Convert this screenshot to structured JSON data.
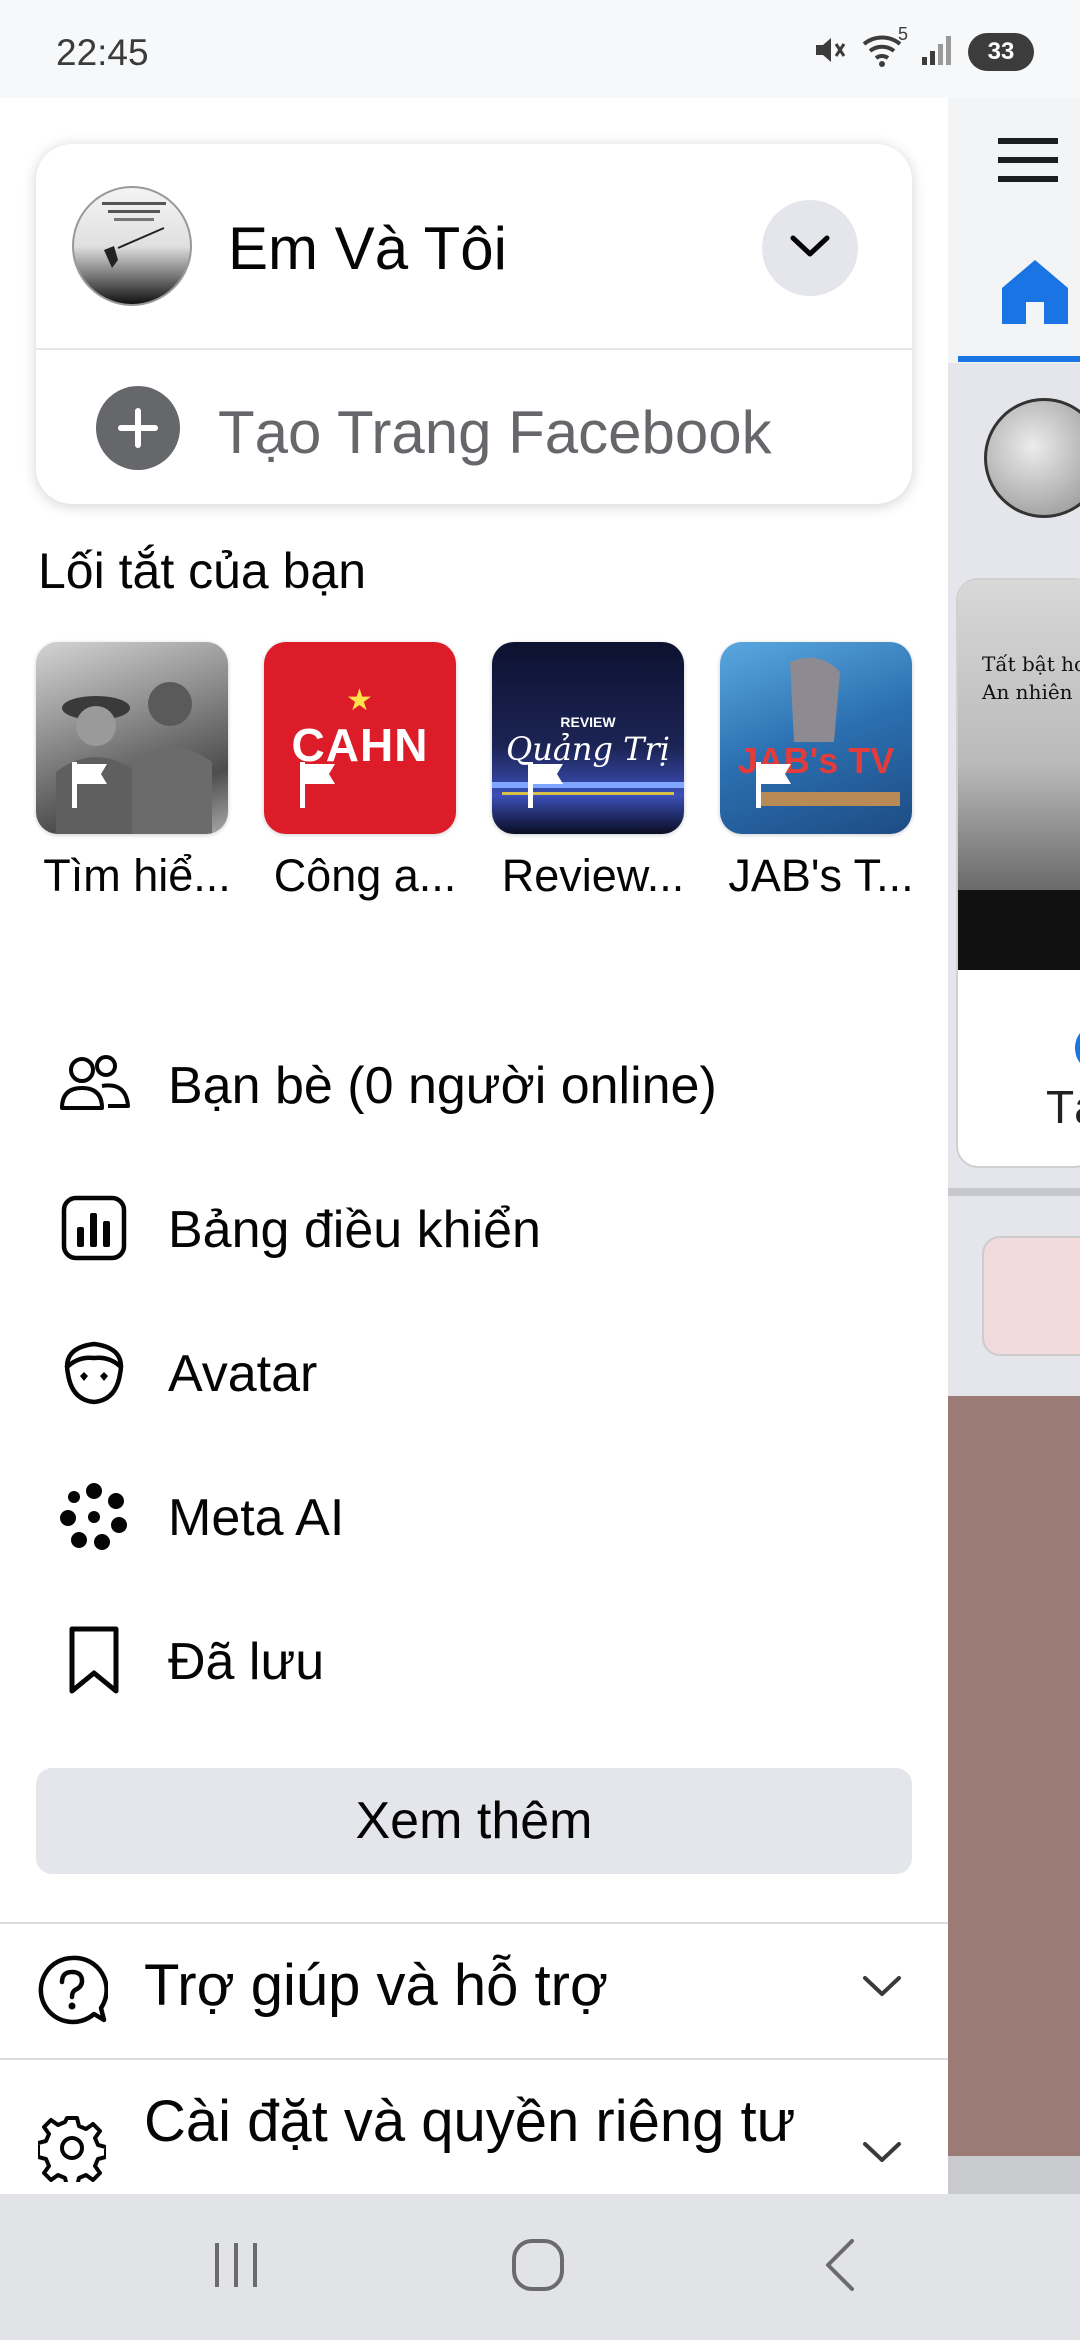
{
  "status_bar": {
    "time": "22:45",
    "wifi_badge": "5",
    "battery": "33",
    "icons": [
      "mute-icon",
      "wifi-icon",
      "signal-icon",
      "battery-icon"
    ]
  },
  "profile": {
    "name": "Em Và Tôi",
    "avatar_icon": "profile-avatar"
  },
  "create_page": {
    "label": "Tạo Trang Facebook"
  },
  "shortcuts": {
    "title": "Lối tắt của bạn",
    "items": [
      {
        "label": "Tìm hiể...",
        "thumb_text": ""
      },
      {
        "label": "Công a...",
        "thumb_text": "CAHN"
      },
      {
        "label": "Review...",
        "thumb_text": "REVIEW"
      },
      {
        "label": "JAB's T...",
        "thumb_text": "JAB's TV"
      }
    ]
  },
  "menu": {
    "items": [
      {
        "label": "Bạn bè (0 người online)",
        "icon": "friends-icon"
      },
      {
        "label": "Bảng điều khiển",
        "icon": "dashboard-icon"
      },
      {
        "label": "Avatar",
        "icon": "avatar-icon"
      },
      {
        "label": "Meta AI",
        "icon": "meta-ai-icon"
      },
      {
        "label": "Đã lưu",
        "icon": "bookmark-icon"
      }
    ],
    "see_more": "Xem thêm"
  },
  "sections": {
    "help": "Trợ giúp và hỗ trợ",
    "settings": "Cài đặt và quyền riêng tư"
  },
  "background_app": {
    "card_text_1": "Tất bật ho",
    "card_text_2": "An nhiên",
    "card_label": "Tạ"
  },
  "colors": {
    "accent": "#1b74e4",
    "secondary_text": "#65676b",
    "button_bg": "#e4e6eb"
  }
}
